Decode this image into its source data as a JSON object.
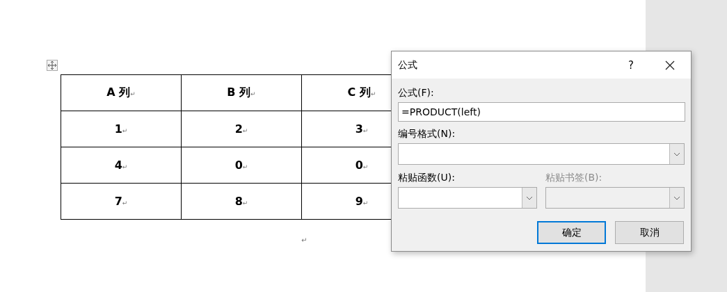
{
  "table": {
    "columns": [
      {
        "text": "A 列",
        "mark": "↵"
      },
      {
        "text": "B 列",
        "mark": "↵"
      },
      {
        "text": "C 列",
        "mark": "↵"
      }
    ],
    "rows": [
      [
        {
          "text": "1",
          "mark": "↵"
        },
        {
          "text": "2",
          "mark": "↵"
        },
        {
          "text": "3",
          "mark": "↵"
        }
      ],
      [
        {
          "text": "4",
          "mark": "↵"
        },
        {
          "text": "0",
          "mark": "↵"
        },
        {
          "text": "0",
          "mark": "↵"
        }
      ],
      [
        {
          "text": "7",
          "mark": "↵"
        },
        {
          "text": "8",
          "mark": "↵"
        },
        {
          "text": "9",
          "mark": "↵"
        }
      ]
    ]
  },
  "end_mark": "↵",
  "dialog": {
    "title": "公式",
    "help": "?",
    "formula": {
      "label": "公式(F):",
      "value": "=PRODUCT(left)"
    },
    "number_format": {
      "label": "编号格式(N):",
      "disabled": false
    },
    "paste_function": {
      "label": "粘贴函数(U):",
      "disabled": false
    },
    "paste_bookmark": {
      "label": "粘贴书签(B):",
      "disabled": true
    },
    "buttons": [
      {
        "label": "确定",
        "selected": true
      },
      {
        "label": "取消",
        "selected": false
      }
    ]
  }
}
